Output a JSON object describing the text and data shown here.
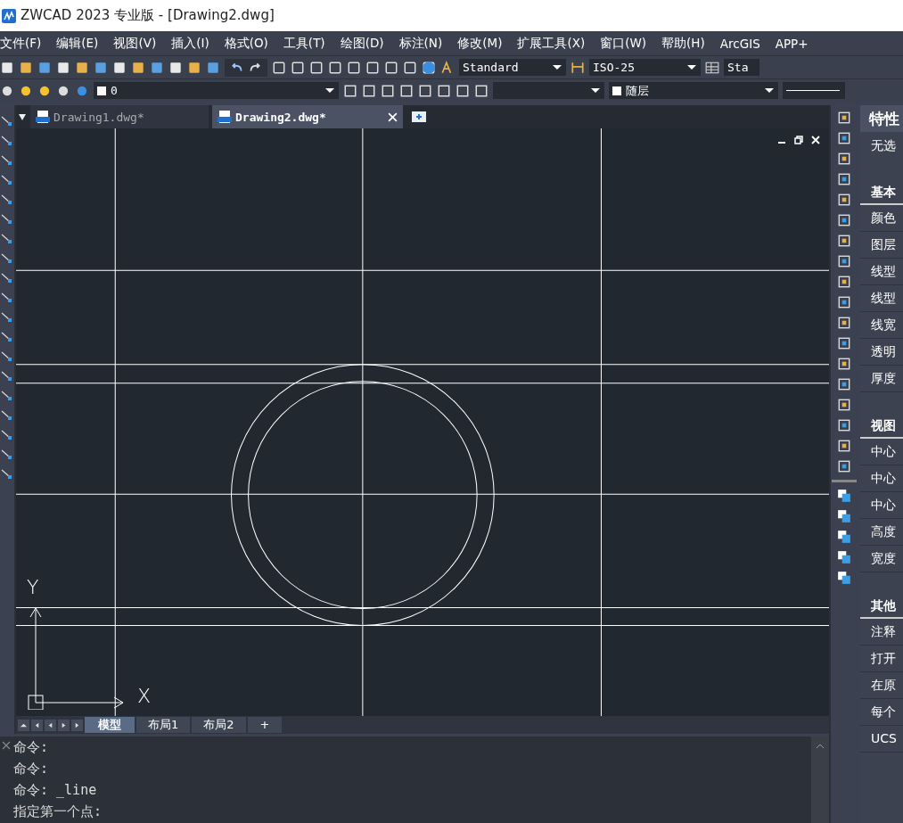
{
  "window": {
    "title": "ZWCAD 2023 专业版 - [Drawing2.dwg]"
  },
  "menu": [
    "文件(F)",
    "编辑(E)",
    "视图(V)",
    "插入(I)",
    "格式(O)",
    "工具(T)",
    "绘图(D)",
    "标注(N)",
    "修改(M)",
    "扩展工具(X)",
    "窗口(W)",
    "帮助(H)",
    "ArcGIS",
    "APP+"
  ],
  "toolbar": {
    "text_style": "Standard",
    "dim_style": "ISO-25",
    "table_style": "Sta",
    "layer": "0",
    "plot_style": "随层"
  },
  "doc_tabs": [
    {
      "label": "Drawing1.dwg*",
      "selected": false
    },
    {
      "label": "Drawing2.dwg*",
      "selected": true
    }
  ],
  "axes": {
    "x": "X",
    "y": "Y"
  },
  "layout_tabs": [
    {
      "label": "模型",
      "selected": true
    },
    {
      "label": "布局1",
      "selected": false
    },
    {
      "label": "布局2",
      "selected": false
    }
  ],
  "add_layout": "+",
  "command_lines": [
    "命令:",
    "命令:",
    "命令: _line",
    "指定第一个点:"
  ],
  "properties": {
    "title": "特性",
    "selection": "无选",
    "sections": [
      {
        "title": "基本",
        "rows": [
          "颜色",
          "图层",
          "线型",
          "线型",
          "线宽",
          "透明",
          "厚度"
        ]
      },
      {
        "title": "视图",
        "rows": [
          "中心",
          "中心",
          "中心",
          "高度",
          "宽度"
        ]
      },
      {
        "title": "其他",
        "rows": [
          "注释",
          "打开",
          "在原",
          "每个",
          "UCS"
        ]
      }
    ]
  }
}
